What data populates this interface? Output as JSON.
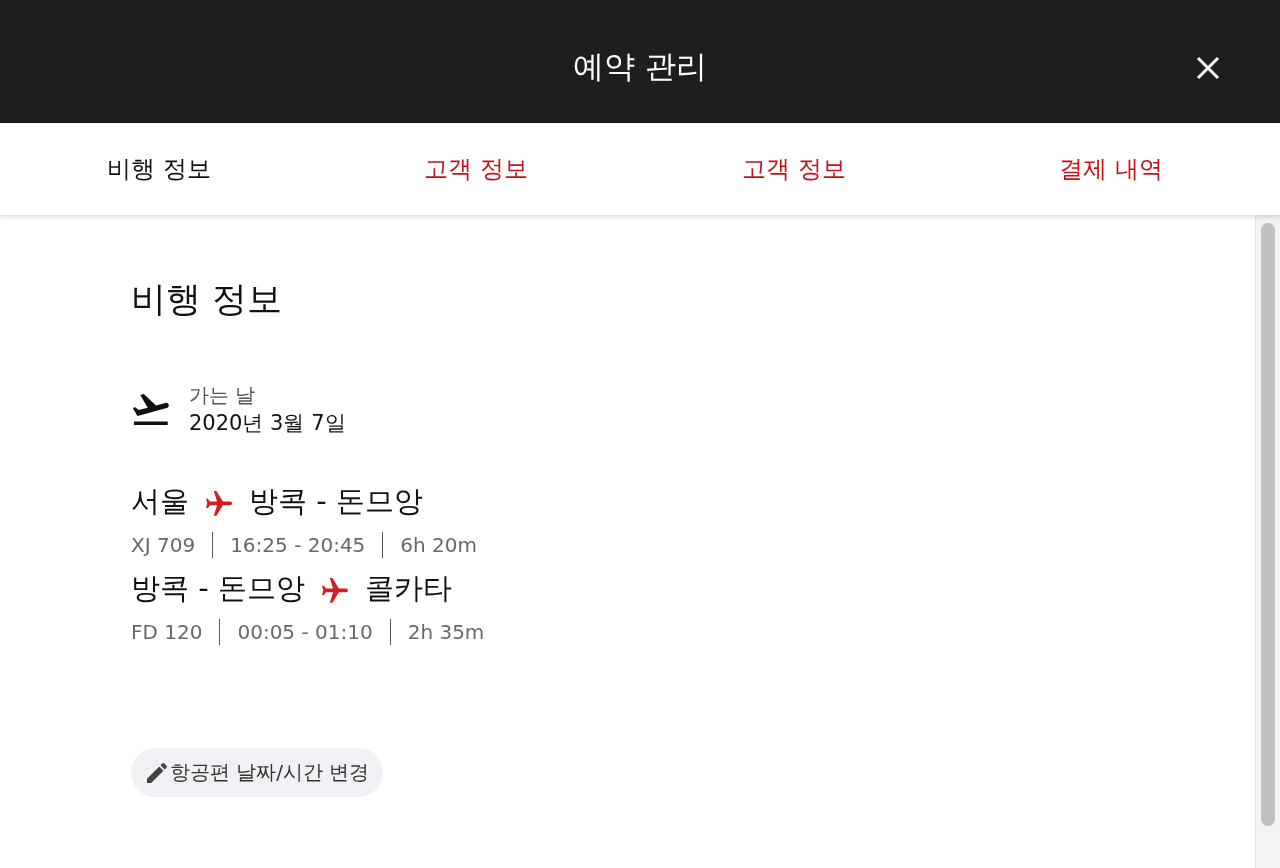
{
  "window": {
    "title": "예약 관리"
  },
  "tabs": [
    {
      "label": "비행 정보",
      "selected": true
    },
    {
      "label": "고객 정보",
      "selected": false
    },
    {
      "label": "고객 정보",
      "selected": false
    },
    {
      "label": "결제 내역",
      "selected": false
    }
  ],
  "section": {
    "title": "비행 정보",
    "departure": {
      "label": "가는 날",
      "date": "2020년 3월 7일"
    },
    "segments": [
      {
        "origin": "서울",
        "destination": "방콕 - 돈므앙",
        "flight": "XJ 709",
        "time": "16:25 - 20:45",
        "duration": "6h 20m"
      },
      {
        "origin": "방콕 - 돈므앙",
        "destination": "콜카타",
        "flight": "FD 120",
        "time": "00:05 - 01:10",
        "duration": "2h 35m"
      }
    ],
    "change_button": {
      "label": "항공편 날짜/시간 변경"
    }
  }
}
